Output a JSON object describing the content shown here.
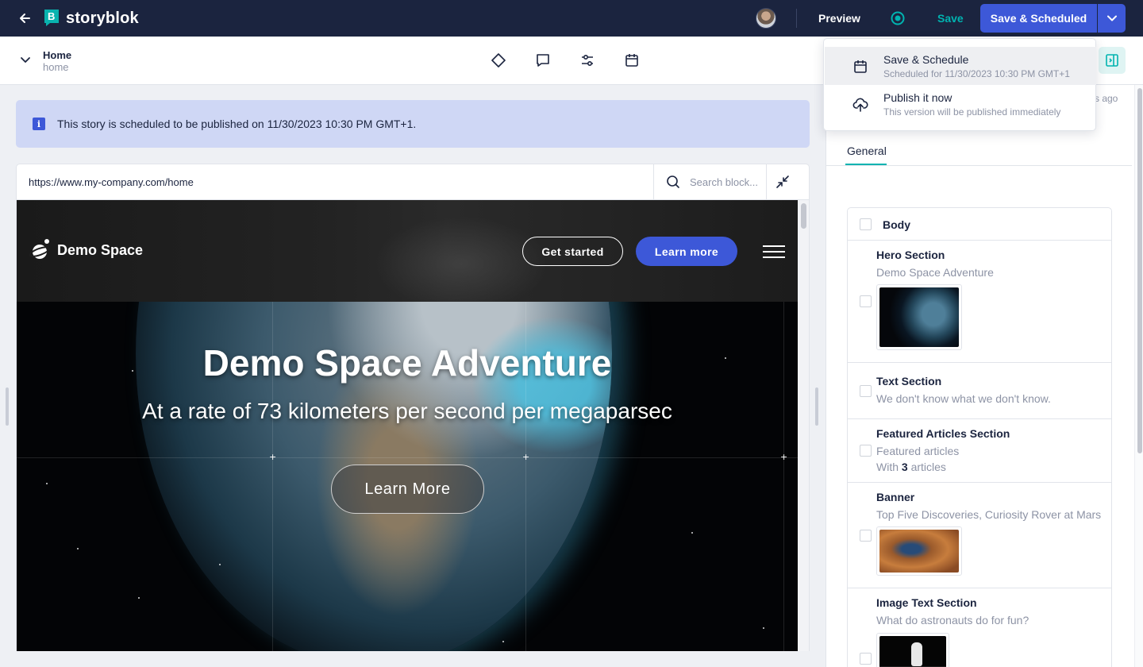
{
  "topbar": {
    "brand": "storyblok",
    "preview_label": "Preview",
    "save_label": "Save",
    "save_scheduled_label": "Save & Scheduled"
  },
  "story": {
    "name": "Home",
    "slug": "home"
  },
  "toolbar": {
    "icons": [
      "diamond-icon",
      "comment-icon",
      "sliders-icon",
      "calendar-icon"
    ]
  },
  "alert": {
    "icon": "info-icon",
    "text": "This story is scheduled to be published on 11/30/2023 10:30 PM GMT+1."
  },
  "preview": {
    "url": "https://www.my-company.com/home",
    "search_placeholder": "Search block..."
  },
  "site": {
    "brand": "Demo Space",
    "get_started_label": "Get started",
    "learn_more_nav_label": "Learn more",
    "hero_title": "Demo Space Adventure",
    "hero_subtitle": "At a rate of 73 kilometers per second per megaparsec",
    "hero_cta_label": "Learn More"
  },
  "right_panel": {
    "ago_text": "s ago",
    "tab_label": "General",
    "body_label": "Body",
    "bloks": [
      {
        "title": "Hero Section",
        "subtitle": "Demo Space Adventure",
        "thumbnail": "earth"
      },
      {
        "title": "Text Section",
        "subtitle": "We don't know what we don't know."
      },
      {
        "title": "Featured Articles Section",
        "subtitle": "Featured articles",
        "extra_prefix": "With ",
        "extra_count": "3",
        "extra_suffix": " articles"
      },
      {
        "title": "Banner",
        "subtitle": "Top Five Discoveries, Curiosity Rover at Mars",
        "thumbnail": "mars"
      },
      {
        "title": "Image Text Section",
        "subtitle": "What do astronauts do for fun?",
        "thumbnail": "moon"
      }
    ]
  },
  "dropdown": {
    "items": [
      {
        "title": "Save & Schedule",
        "subtitle": "Scheduled for 11/30/2023 10:30 PM GMT+1",
        "icon": "calendar-icon"
      },
      {
        "title": "Publish it now",
        "subtitle": "This version will be published immediately",
        "icon": "upload-cloud-icon"
      }
    ]
  },
  "colors": {
    "topbar_bg": "#1b243f",
    "accent_blue": "#3d58d8",
    "accent_teal": "#00b3b0",
    "alert_bg": "#cfd7f5"
  }
}
